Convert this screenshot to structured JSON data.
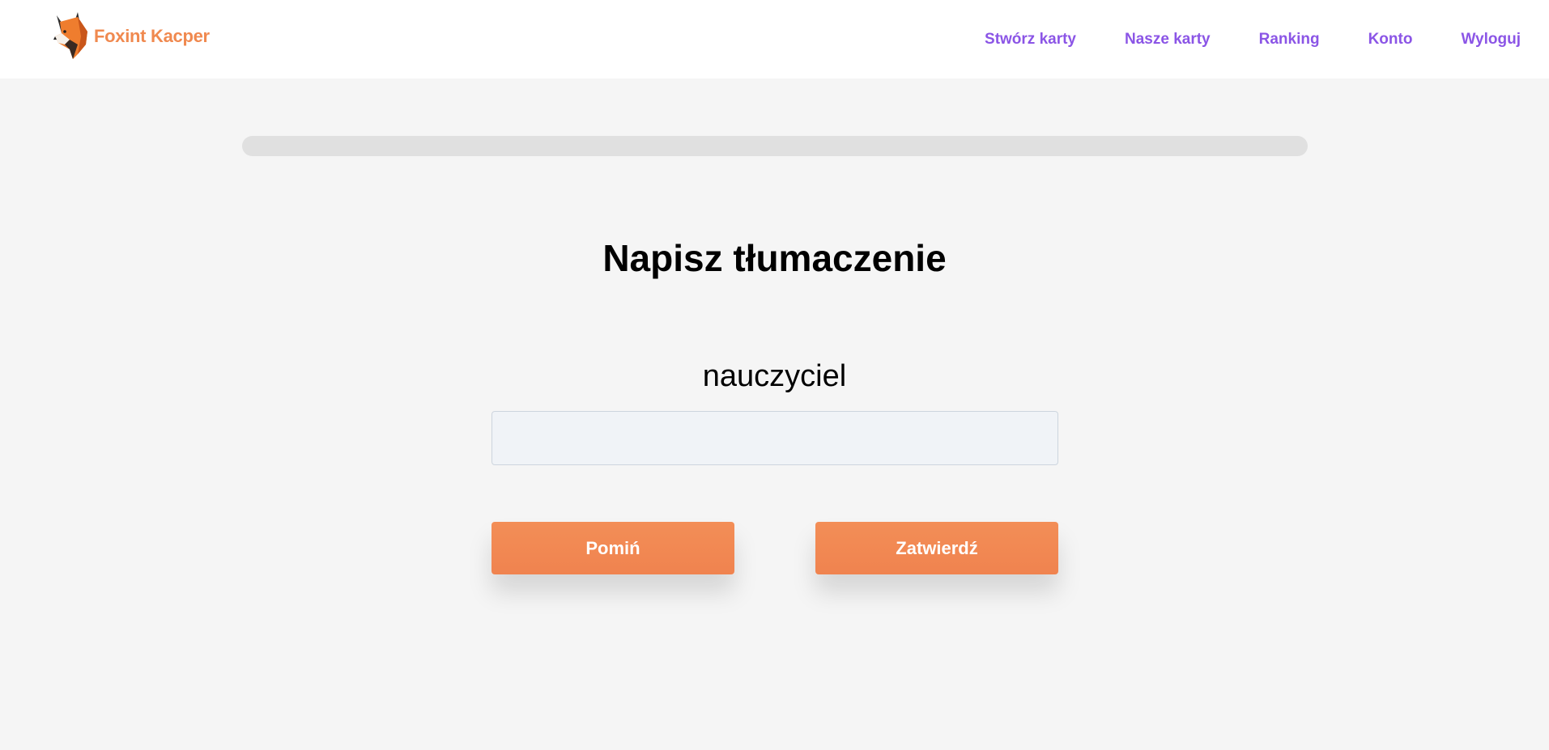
{
  "brand": {
    "name": "Foxint Kacper",
    "icon": "fox-logo-icon",
    "color": "#f0894f"
  },
  "nav": {
    "color": "#8b55e6",
    "items": [
      {
        "label": "Stwórz karty"
      },
      {
        "label": "Nasze karty"
      },
      {
        "label": "Ranking"
      },
      {
        "label": "Konto"
      },
      {
        "label": "Wyloguj"
      }
    ]
  },
  "progress": {
    "fraction": 0
  },
  "main": {
    "title": "Napisz tłumaczenie",
    "word": "nauczyciel",
    "answer_value": "",
    "skip_label": "Pomiń",
    "submit_label": "Zatwierdź",
    "button_color": "#f0894f"
  }
}
